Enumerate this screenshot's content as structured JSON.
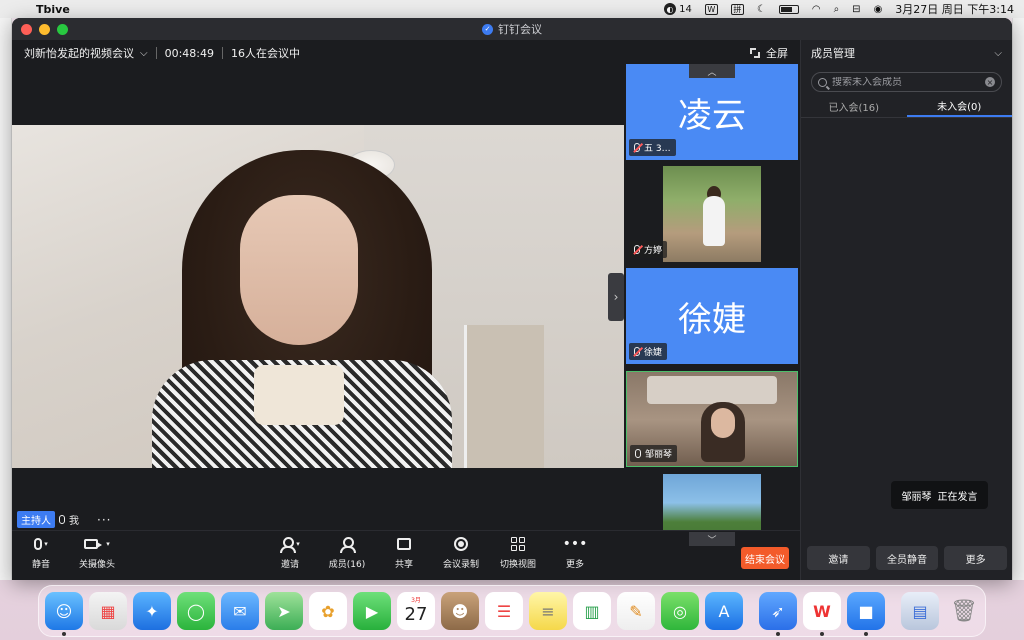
{
  "menubar": {
    "app_name": "Tbive",
    "badge_count": "14",
    "wps_label": "W",
    "pinyin": "拼",
    "clock": "3月27日 周日 下午3:14"
  },
  "window": {
    "title": "钉钉会议"
  },
  "meeting": {
    "name": "刘新怡发起的视频会议",
    "elapsed": "00:48:49",
    "participants_text": "16人在会议中",
    "fullscreen_label": "全屏",
    "host_badge": "主持人",
    "self_label": "我",
    "more_dots": "···"
  },
  "thumbnails": [
    {
      "big_name": "凌云",
      "label": "五 3…",
      "style": "blue"
    },
    {
      "big_name": "",
      "label": "方婷",
      "style": "garden"
    },
    {
      "big_name": "徐婕",
      "label": "徐婕",
      "style": "blue"
    },
    {
      "big_name": "",
      "label": "邹丽琴",
      "style": "room"
    },
    {
      "big_name": "",
      "label": "",
      "style": "tree"
    }
  ],
  "panel": {
    "title": "成员管理",
    "search_placeholder": "搜索未入会成员",
    "tabs": [
      {
        "label": "已入会(16)",
        "active": false
      },
      {
        "label": "未入会(0)",
        "active": true
      }
    ],
    "buttons": [
      "邀请",
      "全员静音",
      "更多"
    ]
  },
  "toast": {
    "speaker": "邹丽琴",
    "status": "正在发言"
  },
  "toolbar": {
    "mute": "静音",
    "camera": "关摄像头",
    "invite": "邀请",
    "members": "成员(16)",
    "share": "共享",
    "record": "会议录制",
    "switch_view": "切换视图",
    "more": "更多",
    "end": "结束会议"
  },
  "dock": {
    "calendar_month": "3月",
    "calendar_day": "27"
  }
}
